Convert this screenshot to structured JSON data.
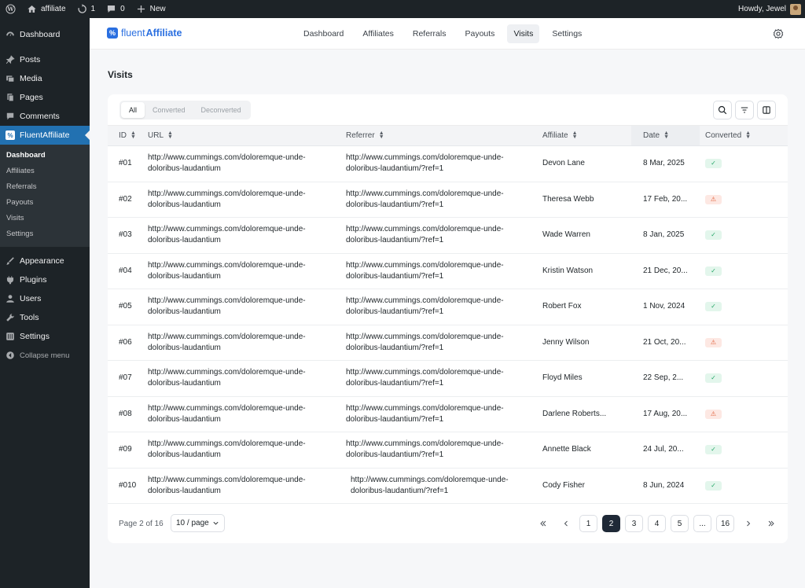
{
  "adminbar": {
    "site_name": "affiliate",
    "updates_count": "1",
    "comments_count": "0",
    "new_label": "New",
    "howdy": "Howdy, Jewel"
  },
  "sidebar": {
    "dashboard": "Dashboard",
    "posts": "Posts",
    "media": "Media",
    "pages": "Pages",
    "comments": "Comments",
    "fluentaffiliate": "FluentAffiliate",
    "sub": [
      "Dashboard",
      "Affiliates",
      "Referrals",
      "Payouts",
      "Visits",
      "Settings"
    ],
    "appearance": "Appearance",
    "plugins": "Plugins",
    "users": "Users",
    "tools": "Tools",
    "settings": "Settings",
    "collapse": "Collapse menu"
  },
  "app": {
    "logo_light": "fluent",
    "logo_bold": "Affiliate",
    "tabs": [
      "Dashboard",
      "Affiliates",
      "Referrals",
      "Payouts",
      "Visits",
      "Settings"
    ],
    "active_tab": "Visits"
  },
  "page": {
    "title": "Visits",
    "filters": [
      "All",
      "Converted",
      "Deconverted"
    ],
    "active_filter": "All",
    "columns": [
      "ID",
      "URL",
      "Referrer",
      "Affiliate",
      "Date",
      "Converted"
    ],
    "rows": [
      {
        "id": "#01",
        "url1": "http://www.cummings.com/doloremque-unde-",
        "url2": "doloribus-laudantium",
        "ref1": "http://www.cummings.com/doloremque-unde-",
        "ref2": "doloribus-laudantium/?ref=1",
        "affiliate": "Devon Lane",
        "date": "8 Mar, 2025",
        "converted": "ok"
      },
      {
        "id": "#02",
        "url1": "http://www.cummings.com/doloremque-unde-",
        "url2": "doloribus-laudantium",
        "ref1": "http://www.cummings.com/doloremque-unde-",
        "ref2": "doloribus-laudantium/?ref=1",
        "affiliate": "Theresa Webb",
        "date": "17 Feb, 20...",
        "converted": "warn"
      },
      {
        "id": "#03",
        "url1": "http://www.cummings.com/doloremque-unde-",
        "url2": "doloribus-laudantium",
        "ref1": "http://www.cummings.com/doloremque-unde-",
        "ref2": "doloribus-laudantium/?ref=1",
        "affiliate": "Wade Warren",
        "date": "8 Jan, 2025",
        "converted": "ok"
      },
      {
        "id": "#04",
        "url1": "http://www.cummings.com/doloremque-unde-",
        "url2": "doloribus-laudantium",
        "ref1": "http://www.cummings.com/doloremque-unde-",
        "ref2": "doloribus-laudantium/?ref=1",
        "affiliate": "Kristin Watson",
        "date": "21 Dec, 20...",
        "converted": "ok"
      },
      {
        "id": "#05",
        "url1": "http://www.cummings.com/doloremque-unde-",
        "url2": "doloribus-laudantium",
        "ref1": "http://www.cummings.com/doloremque-unde-",
        "ref2": "doloribus-laudantium/?ref=1",
        "affiliate": "Robert Fox",
        "date": "1 Nov, 2024",
        "converted": "ok"
      },
      {
        "id": "#06",
        "url1": "http://www.cummings.com/doloremque-unde-",
        "url2": "doloribus-laudantium",
        "ref1": "http://www.cummings.com/doloremque-unde-",
        "ref2": "doloribus-laudantium/?ref=1",
        "affiliate": "Jenny Wilson",
        "date": "21 Oct, 20...",
        "converted": "warn"
      },
      {
        "id": "#07",
        "url1": "http://www.cummings.com/doloremque-unde-",
        "url2": "doloribus-laudantium",
        "ref1": "http://www.cummings.com/doloremque-unde-",
        "ref2": "doloribus-laudantium/?ref=1",
        "affiliate": "Floyd Miles",
        "date": "22 Sep, 2...",
        "converted": "ok"
      },
      {
        "id": "#08",
        "url1": "http://www.cummings.com/doloremque-unde-",
        "url2": "doloribus-laudantium",
        "ref1": "http://www.cummings.com/doloremque-unde-",
        "ref2": "doloribus-laudantium/?ref=1",
        "affiliate": "Darlene Roberts...",
        "date": "17 Aug, 20...",
        "converted": "warn"
      },
      {
        "id": "#09",
        "url1": "http://www.cummings.com/doloremque-unde-",
        "url2": "doloribus-laudantium",
        "ref1": "http://www.cummings.com/doloremque-unde-",
        "ref2": "doloribus-laudantium/?ref=1",
        "affiliate": "Annette Black",
        "date": "24 Jul, 20...",
        "converted": "ok"
      },
      {
        "id": "#010",
        "url1": "http://www.cummings.com/doloremque-unde-",
        "url2": "doloribus-laudantium",
        "ref1": "http://www.cummings.com/doloremque-unde-",
        "ref2": "doloribus-laudantium/?ref=1",
        "affiliate": "Cody Fisher",
        "date": "8 Jun, 2024",
        "converted": "ok"
      }
    ],
    "pagination": {
      "info": "Page 2 of 16",
      "per_page": "10 / page",
      "pages": [
        "1",
        "2",
        "3",
        "4",
        "5",
        "...",
        "16"
      ],
      "current": "2"
    }
  },
  "colors": {
    "accent": "#2271b1",
    "brand": "#2a6fe0",
    "ok": "#23a566",
    "warn": "#e0603a"
  }
}
